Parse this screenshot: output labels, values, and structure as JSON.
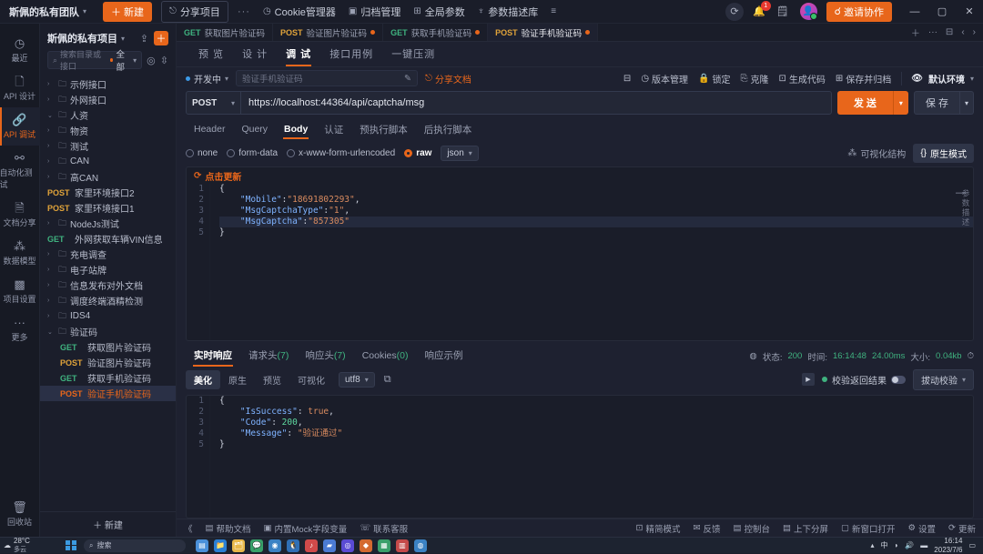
{
  "titlebar": {
    "team": "斯佩的私有团队",
    "new_button": "新建",
    "share_project": "分享项目",
    "dots": "···",
    "items": [
      {
        "label": "Cookie管理器",
        "icon": "clock-icon"
      },
      {
        "label": "归档管理",
        "icon": "archive-icon"
      },
      {
        "label": "全局参数",
        "icon": "params-icon"
      },
      {
        "label": "参数描述库",
        "icon": "bulb-icon"
      }
    ],
    "menu_icon": "menu-icon",
    "refresh_icon": "refresh-icon",
    "bell_icon": "bell-icon",
    "bell_badge": "1",
    "note_icon": "note-icon",
    "invite_button": "邀请协作",
    "minimize": "—",
    "maximize": "▢",
    "close": "✕"
  },
  "rail": {
    "items": [
      {
        "label": "最近",
        "icon": "clock-icon",
        "active": false
      },
      {
        "label": "API 设计",
        "icon": "doc-icon",
        "active": false
      },
      {
        "label": "API 调试",
        "icon": "link-icon",
        "active": true
      },
      {
        "label": "自动化测试",
        "icon": "flow-icon",
        "active": false
      },
      {
        "label": "文档分享",
        "icon": "share-doc-icon",
        "active": false
      },
      {
        "label": "数据模型",
        "icon": "model-icon",
        "active": false
      },
      {
        "label": "项目设置",
        "icon": "settings-icon",
        "active": false
      },
      {
        "label": "更多",
        "icon": "more-icon",
        "active": false
      }
    ],
    "bottom": {
      "label": "回收站",
      "icon": "trash-icon"
    }
  },
  "tree": {
    "project_name": "斯佩的私有项目",
    "search_placeholder": "搜索目录或接口",
    "filter_label": "全部",
    "new_label": "新建",
    "nodes": [
      {
        "type": "folder",
        "label": "示例接口",
        "expanded": false,
        "depth": 0
      },
      {
        "type": "folder",
        "label": "外网接口",
        "expanded": false,
        "depth": 0
      },
      {
        "type": "folder",
        "label": "人资",
        "expanded": true,
        "depth": 0
      },
      {
        "type": "folder",
        "label": "物资",
        "expanded": false,
        "depth": 0
      },
      {
        "type": "folder",
        "label": "测试",
        "expanded": false,
        "depth": 0
      },
      {
        "type": "folder",
        "label": "CAN",
        "expanded": false,
        "depth": 0
      },
      {
        "type": "folder",
        "label": "高CAN",
        "expanded": false,
        "depth": 0
      },
      {
        "type": "api",
        "method": "POST",
        "label": "家里环境接口2",
        "depth": 0
      },
      {
        "type": "api",
        "method": "POST",
        "label": "家里环境接口1",
        "depth": 0
      },
      {
        "type": "folder",
        "label": "NodeJs测试",
        "expanded": false,
        "depth": 0
      },
      {
        "type": "api",
        "method": "GET",
        "label": "外网获取车辆VIN信息",
        "depth": 0
      },
      {
        "type": "folder",
        "label": "充电调查",
        "expanded": false,
        "depth": 0
      },
      {
        "type": "folder",
        "label": "电子站牌",
        "expanded": false,
        "depth": 0
      },
      {
        "type": "folder",
        "label": "信息发布对外文档",
        "expanded": false,
        "depth": 0
      },
      {
        "type": "folder",
        "label": "调度终端酒精检测",
        "expanded": false,
        "depth": 0
      },
      {
        "type": "folder",
        "label": "IDS4",
        "expanded": false,
        "depth": 0
      },
      {
        "type": "folder",
        "label": "验证码",
        "expanded": true,
        "depth": 0
      },
      {
        "type": "api",
        "method": "GET",
        "label": "获取图片验证码",
        "depth": 1
      },
      {
        "type": "api",
        "method": "POST",
        "label": "验证图片验证码",
        "depth": 1
      },
      {
        "type": "api",
        "method": "GET",
        "label": "获取手机验证码",
        "depth": 1
      },
      {
        "type": "api",
        "method": "POST",
        "label": "验证手机验证码",
        "depth": 1,
        "selected": true
      }
    ]
  },
  "request_tabs": [
    {
      "method": "GET",
      "label": "获取图片验证码",
      "modified": false,
      "active": false
    },
    {
      "method": "POST",
      "label": "验证图片验证码",
      "modified": true,
      "active": false
    },
    {
      "method": "GET",
      "label": "获取手机验证码",
      "modified": true,
      "active": false
    },
    {
      "method": "POST",
      "label": "验证手机验证码",
      "modified": true,
      "active": true
    }
  ],
  "subtabs": [
    {
      "label": "预 览",
      "active": false
    },
    {
      "label": "设 计",
      "active": false
    },
    {
      "label": "调 试",
      "active": true
    },
    {
      "label": "接口用例",
      "active": false
    },
    {
      "label": "一键压测",
      "active": false
    }
  ],
  "meta": {
    "status": "开发中",
    "api_name": "验证手机验证码",
    "share_doc": "分享文档",
    "actions": [
      {
        "label": "版本管理",
        "icon": "history-icon"
      },
      {
        "label": "锁定",
        "icon": "lock-icon"
      },
      {
        "label": "克隆",
        "icon": "clone-icon"
      },
      {
        "label": "生成代码",
        "icon": "code-icon"
      },
      {
        "label": "保存并归档",
        "icon": "archive-icon"
      }
    ],
    "env": "默认环境",
    "eye_icon": "eye-icon",
    "collapse_icon": "collapse-icon"
  },
  "url_bar": {
    "method": "POST",
    "url": "https://localhost:44364/api/captcha/msg",
    "send": "发 送",
    "save": "保 存"
  },
  "req_tabs": [
    {
      "label": "Header",
      "active": false
    },
    {
      "label": "Query",
      "active": false
    },
    {
      "label": "Body",
      "active": true
    },
    {
      "label": "认证",
      "active": false
    },
    {
      "label": "预执行脚本",
      "active": false
    },
    {
      "label": "后执行脚本",
      "active": false
    }
  ],
  "body_options": {
    "radios": [
      {
        "label": "none",
        "selected": false
      },
      {
        "label": "form-data",
        "selected": false
      },
      {
        "label": "x-www-form-urlencoded",
        "selected": false
      },
      {
        "label": "raw",
        "selected": true
      }
    ],
    "format": "json",
    "view_struct": "可视化结构",
    "view_raw": "原生模式",
    "update_hint": "点击更新"
  },
  "request_body": {
    "lines": [
      {
        "no": "1",
        "tokens": [
          {
            "t": "{",
            "c": "p"
          }
        ]
      },
      {
        "no": "2",
        "tokens": [
          {
            "t": "    ",
            "c": "p"
          },
          {
            "t": "\"Mobile\"",
            "c": "k"
          },
          {
            "t": ":",
            "c": "p"
          },
          {
            "t": "\"18691802293\"",
            "c": "s"
          },
          {
            "t": ",",
            "c": "p"
          }
        ]
      },
      {
        "no": "3",
        "tokens": [
          {
            "t": "    ",
            "c": "p"
          },
          {
            "t": "\"MsgCaptchaType\"",
            "c": "k"
          },
          {
            "t": ":",
            "c": "p"
          },
          {
            "t": "\"1\"",
            "c": "s"
          },
          {
            "t": ",",
            "c": "p"
          }
        ]
      },
      {
        "no": "4",
        "tokens": [
          {
            "t": "    ",
            "c": "p"
          },
          {
            "t": "\"MsgCaptcha\"",
            "c": "k"
          },
          {
            "t": ":",
            "c": "p"
          },
          {
            "t": "\"857305\"",
            "c": "s"
          }
        ],
        "highlight": true
      },
      {
        "no": "5",
        "tokens": [
          {
            "t": "}",
            "c": "p"
          }
        ]
      }
    ],
    "side_label": "参数描述"
  },
  "response": {
    "tabs": [
      {
        "label": "实时响应",
        "count": "",
        "active": true
      },
      {
        "label": "请求头",
        "count": "(7)",
        "active": false
      },
      {
        "label": "响应头",
        "count": "(7)",
        "active": false
      },
      {
        "label": "Cookies",
        "count": "(0)",
        "active": false
      },
      {
        "label": "响应示例",
        "count": "",
        "active": false
      }
    ],
    "status_label": "状态:",
    "status_value": "200",
    "time_label": "时间:",
    "time_value": "16:14:48",
    "duration": "24.00ms",
    "size_label": "大小:",
    "size_value": "0.04kb",
    "view_options": [
      {
        "label": "美化",
        "active": true
      },
      {
        "label": "原生",
        "active": false
      },
      {
        "label": "预览",
        "active": false
      },
      {
        "label": "可视化",
        "active": false
      }
    ],
    "encoding": "utf8",
    "verify_label": "校验返回结果",
    "assert_button": "拔动校验",
    "body_lines": [
      {
        "no": "1",
        "tokens": [
          {
            "t": "{",
            "c": "p"
          }
        ]
      },
      {
        "no": "2",
        "tokens": [
          {
            "t": "    ",
            "c": "p"
          },
          {
            "t": "\"IsSuccess\"",
            "c": "k"
          },
          {
            "t": ": ",
            "c": "p"
          },
          {
            "t": "true",
            "c": "b"
          },
          {
            "t": ",",
            "c": "p"
          }
        ]
      },
      {
        "no": "3",
        "tokens": [
          {
            "t": "    ",
            "c": "p"
          },
          {
            "t": "\"Code\"",
            "c": "k"
          },
          {
            "t": ": ",
            "c": "p"
          },
          {
            "t": "200",
            "c": "n"
          },
          {
            "t": ",",
            "c": "p"
          }
        ]
      },
      {
        "no": "4",
        "tokens": [
          {
            "t": "    ",
            "c": "p"
          },
          {
            "t": "\"Message\"",
            "c": "k"
          },
          {
            "t": ": ",
            "c": "p"
          },
          {
            "t": "\"验证通过\"",
            "c": "s"
          }
        ]
      },
      {
        "no": "5",
        "tokens": [
          {
            "t": "}",
            "c": "p"
          }
        ]
      }
    ]
  },
  "content_footer": {
    "left": [
      {
        "label": "帮助文档",
        "icon": "book-icon"
      },
      {
        "label": "内置Mock字段变量",
        "icon": "mock-icon"
      },
      {
        "label": "联系客服",
        "icon": "service-icon"
      }
    ],
    "right": [
      {
        "label": "精简模式",
        "icon": "simple-icon"
      },
      {
        "label": "反馈",
        "icon": "feedback-icon"
      },
      {
        "label": "控制台",
        "icon": "console-icon"
      },
      {
        "label": "上下分屏",
        "icon": "split-icon"
      },
      {
        "label": "新窗口打开",
        "icon": "window-icon"
      },
      {
        "label": "设置",
        "icon": "gear-icon"
      },
      {
        "label": "更新",
        "icon": "update-icon"
      }
    ]
  },
  "taskbar": {
    "weather_temp": "28°C",
    "weather_desc": "多云",
    "search_placeholder": "搜索",
    "clock_time": "16:14",
    "clock_date": "2023/7/6",
    "tray_lang": "中",
    "tray_icons": [
      "wifi-icon",
      "volume-icon",
      "battery-icon"
    ]
  }
}
